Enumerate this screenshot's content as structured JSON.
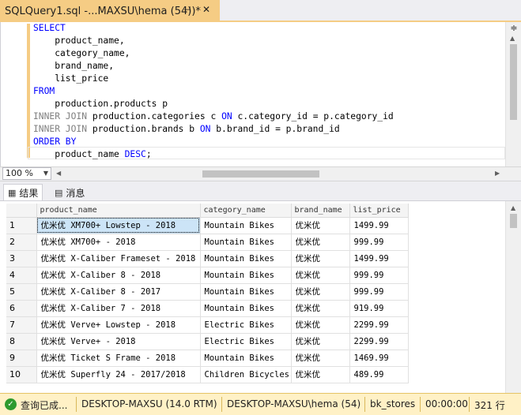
{
  "tab": {
    "title": "SQLQuery1.sql -...MAXSU\\hema (54))*",
    "pin_icon": "pin-icon",
    "close_icon": "close-icon"
  },
  "editor": {
    "lines": [
      [
        {
          "t": "SELECT",
          "c": "kw"
        }
      ],
      [
        {
          "t": "    product_name,",
          "c": ""
        }
      ],
      [
        {
          "t": "    category_name,",
          "c": ""
        }
      ],
      [
        {
          "t": "    brand_name,",
          "c": ""
        }
      ],
      [
        {
          "t": "    list_price",
          "c": ""
        }
      ],
      [
        {
          "t": "FROM",
          "c": "kw"
        }
      ],
      [
        {
          "t": "    production.products p",
          "c": ""
        }
      ],
      [
        {
          "t": "INNER JOIN",
          "c": "gr"
        },
        {
          "t": " production.categories c ",
          "c": ""
        },
        {
          "t": "ON",
          "c": "kw"
        },
        {
          "t": " c.category_id = p.category_id",
          "c": ""
        }
      ],
      [
        {
          "t": "INNER JOIN",
          "c": "gr"
        },
        {
          "t": " production.brands b ",
          "c": ""
        },
        {
          "t": "ON",
          "c": "kw"
        },
        {
          "t": " b.brand_id = p.brand_id",
          "c": ""
        }
      ],
      [
        {
          "t": "ORDER BY",
          "c": "kw"
        }
      ],
      [
        {
          "t": "    product_name ",
          "c": ""
        },
        {
          "t": "DESC",
          "c": "kw"
        },
        {
          "t": ";",
          "c": ""
        }
      ]
    ]
  },
  "zoom": {
    "value": "100 %"
  },
  "result_tabs": [
    {
      "label": "结果",
      "icon": "grid-icon"
    },
    {
      "label": "消息",
      "icon": "message-icon"
    }
  ],
  "grid": {
    "columns": [
      "product_name",
      "category_name",
      "brand_name",
      "list_price"
    ],
    "rows": [
      [
        "1",
        "优米优 XM700+ Lowstep - 2018",
        "Mountain Bikes",
        "优米优",
        "1499.99"
      ],
      [
        "2",
        "优米优 XM700+ - 2018",
        "Mountain Bikes",
        "优米优",
        "999.99"
      ],
      [
        "3",
        "优米优 X-Caliber Frameset - 2018",
        "Mountain Bikes",
        "优米优",
        "1499.99"
      ],
      [
        "4",
        "优米优 X-Caliber 8 - 2018",
        "Mountain Bikes",
        "优米优",
        "999.99"
      ],
      [
        "5",
        "优米优 X-Caliber 8 - 2017",
        "Mountain Bikes",
        "优米优",
        "999.99"
      ],
      [
        "6",
        "优米优 X-Caliber 7 - 2018",
        "Mountain Bikes",
        "优米优",
        "919.99"
      ],
      [
        "7",
        "优米优 Verve+ Lowstep - 2018",
        "Electric Bikes",
        "优米优",
        "2299.99"
      ],
      [
        "8",
        "优米优 Verve+ - 2018",
        "Electric Bikes",
        "优米优",
        "2299.99"
      ],
      [
        "9",
        "优米优 Ticket S Frame - 2018",
        "Mountain Bikes",
        "优米优",
        "1469.99"
      ],
      [
        "10",
        "优米优 Superfly 24 - 2017/2018",
        "Children Bicycles",
        "优米优",
        "489.99"
      ]
    ]
  },
  "status": {
    "query_state": "查询已成...",
    "server": "DESKTOP-MAXSU (14.0 RTM)",
    "user": "DESKTOP-MAXSU\\hema (54)",
    "database": "bk_stores",
    "elapsed": "00:00:00",
    "row_count": "321 行"
  }
}
